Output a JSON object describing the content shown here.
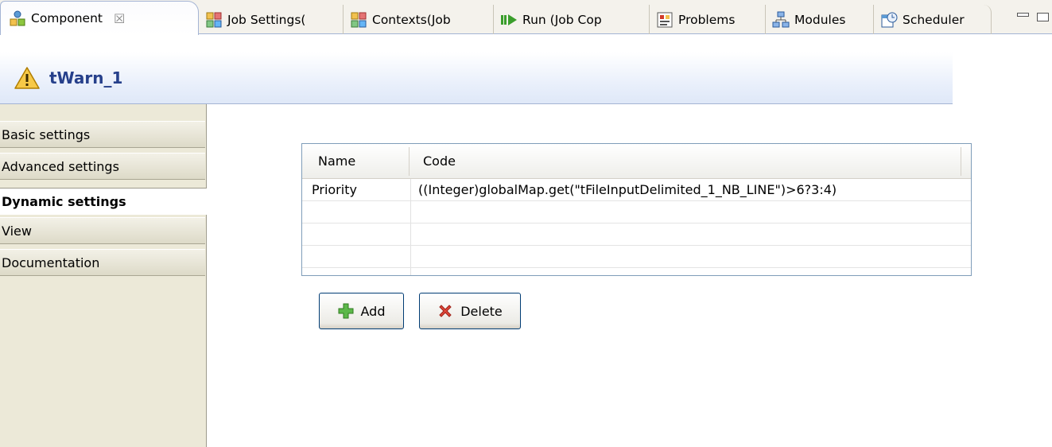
{
  "tabs": [
    {
      "label": "Component",
      "icon": "component-icon",
      "active": true,
      "closable": true
    },
    {
      "label": "Job Settings(",
      "icon": "job-settings-icon"
    },
    {
      "label": "Contexts(Job",
      "icon": "contexts-icon"
    },
    {
      "label": "Run (Job Cop",
      "icon": "run-icon"
    },
    {
      "label": "Problems",
      "icon": "problems-icon"
    },
    {
      "label": "Modules",
      "icon": "modules-icon"
    },
    {
      "label": "Scheduler",
      "icon": "scheduler-icon"
    }
  ],
  "close_glyph": "☒",
  "header": {
    "title": "tWarn_1",
    "icon": "warning-icon"
  },
  "nav": {
    "items": [
      {
        "label": "Basic settings"
      },
      {
        "label": "Advanced settings"
      },
      {
        "label": "Dynamic settings",
        "selected": true
      },
      {
        "label": "View"
      },
      {
        "label": "Documentation"
      }
    ]
  },
  "table": {
    "columns": [
      "Name",
      "Code"
    ],
    "rows": [
      {
        "name": "Priority",
        "code": "((Integer)globalMap.get(\"tFileInputDelimited_1_NB_LINE\")>6?3:4)"
      }
    ]
  },
  "buttons": {
    "add_label": "Add",
    "delete_label": "Delete"
  },
  "colors": {
    "header_title": "#26408b",
    "tab_border": "#a4b4d4",
    "panel_bg": "#ece9d8",
    "add_green": "#3a9e2c",
    "delete_red": "#d23b2a"
  }
}
